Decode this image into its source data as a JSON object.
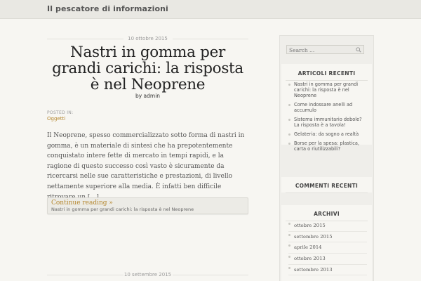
{
  "header": {
    "site_title": "Il pescatore di informazioni"
  },
  "post": {
    "date": "10 ottobre 2015",
    "title": "Nastri in gomma per grandi carichi: la risposta è nel Neoprene",
    "byline": "by admin",
    "posted_in_label": "POSTED IN:",
    "category": "Oggetti",
    "excerpt": "Il Neoprene, spesso commercializzato sotto forma di nastri in gomma, è un materiale di sintesi che ha prepotentemente conquistato intere fette di mercato in tempi rapidi, e la ragione di questo successo così vasto è sicuramente da ricercarsi nelle sue caratteristiche e prestazioni, di livello nettamente superiore alla media. È infatti ben difficile ritrovare un […]",
    "continue_label": "Continue reading »",
    "continue_title": "Nastri in gomma per grandi carichi: la risposta è nel Neoprene"
  },
  "next_post": {
    "date": "10 settembre 2015"
  },
  "sidebar": {
    "search": {
      "placeholder": "Search ..."
    },
    "recent_posts": {
      "title": "ARTICOLI RECENTI",
      "items": [
        "Nastri in gomma per grandi carichi: la risposta è nel Neoprene",
        "Come indossare anelli ad accumulo",
        "Sistema immunitario debole? La risposta è a tavola!",
        "Gelateria: da sogno a realtà",
        "Borse per la spesa: plastica, carta o riutilizzabili?"
      ]
    },
    "recent_comments": {
      "title": "COMMENTI RECENTI"
    },
    "archives": {
      "title": "ARCHIVI",
      "items": [
        "ottobre 2015",
        "settembre 2015",
        "aprile 2014",
        "ottobre 2013",
        "settembre 2013"
      ]
    }
  },
  "colors": {
    "accent": "#b5872f",
    "background": "#f7f6f2",
    "header_bg": "#e9e8e3"
  }
}
